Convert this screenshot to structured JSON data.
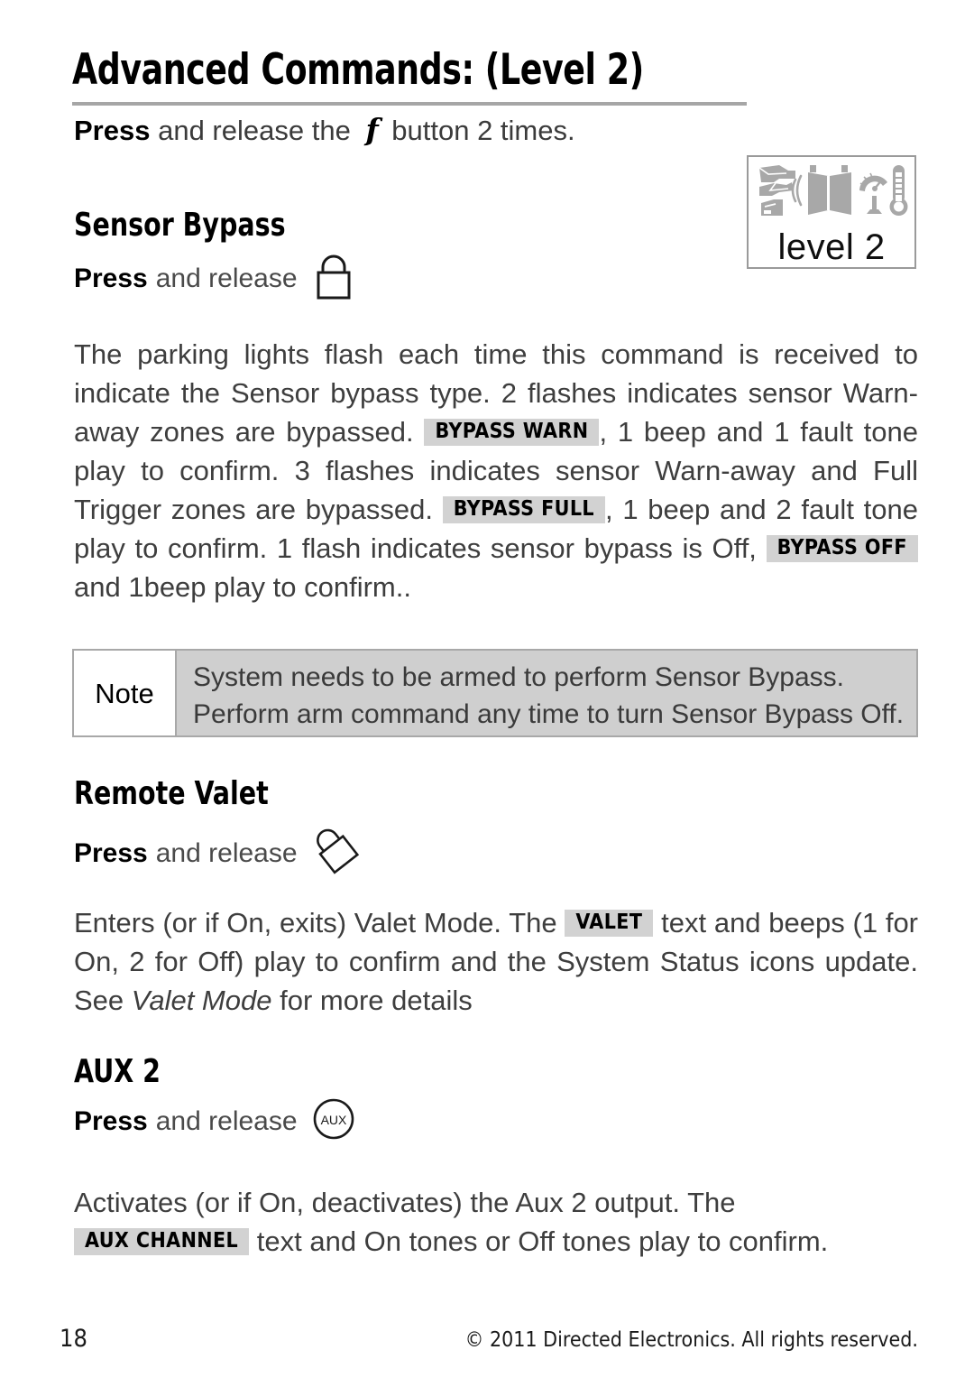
{
  "page": {
    "title": "Advanced Commands: (Level 2)",
    "intro_prefix": "Press",
    "intro_middle": "and release the",
    "intro_icon": "f",
    "intro_suffix": "button 2 times.",
    "page_number": "18",
    "copyright": "© 2011 Directed Electronics. All rights reserved."
  },
  "level_badge": {
    "label": "level 2",
    "icons": [
      "car-hood-icon",
      "car-trunk-icon",
      "car-door-icon",
      "sound-wave-icon",
      "door-panels-icon",
      "gauge-icon",
      "thermometer-icon"
    ]
  },
  "sections": [
    {
      "id": "sensor-bypass",
      "heading": "Sensor Bypass",
      "press_label": "Press",
      "action_label": "and release",
      "icon": "padlock-closed-icon",
      "body": {
        "t1": "The parking lights flash each time this command is received to indicate the Sensor bypass type. 2 flashes indicates sensor Warn-away zones are bypassed.",
        "badge1": "BYPASS WARN",
        "t2": ", 1 beep and 1 fault tone play to confirm. 3 flashes indicates sensor Warn-away and Full Trigger zones are bypassed.",
        "badge2": "BYPASS FULL",
        "t3": ", 1 beep and 2 fault tone play to confirm. 1 flash indicates sensor bypass is Off,",
        "badge3": "BYPASS OFF",
        "t4": "and 1beep play to confirm.."
      }
    },
    {
      "id": "remote-valet",
      "heading": "Remote Valet",
      "press_label": "Press",
      "action_label": "and release",
      "icon": "padlock-open-icon",
      "body": {
        "t1": "Enters (or if On, exits) Valet Mode. The",
        "badge1": "VALET",
        "t2": "text and beeps (1 for On, 2 for Off) play to confirm and the System Status icons update. See",
        "italic1": "Valet Mode",
        "t3": "for more details"
      }
    },
    {
      "id": "aux-2",
      "heading": "AUX 2",
      "press_label": "Press",
      "action_label": "and release",
      "icon": "aux-button-icon",
      "icon_text": "AUX",
      "body": {
        "t1": "Activates (or if On, deactivates) the Aux 2 output. The",
        "badge1": "AUX CHANNEL",
        "t2": "text and On tones or Off tones play to confirm."
      }
    }
  ],
  "note": {
    "label": "Note",
    "line1": "System needs to be armed to perform Sensor Bypass.",
    "line2": "Perform arm command any time to turn Sensor Bypass Off."
  },
  "colors": {
    "badge_bg": "#d2d2d2",
    "note_bg": "#cfcfcf",
    "rule": "#a6a6a6",
    "icon_gray": "#a8a8a8"
  }
}
